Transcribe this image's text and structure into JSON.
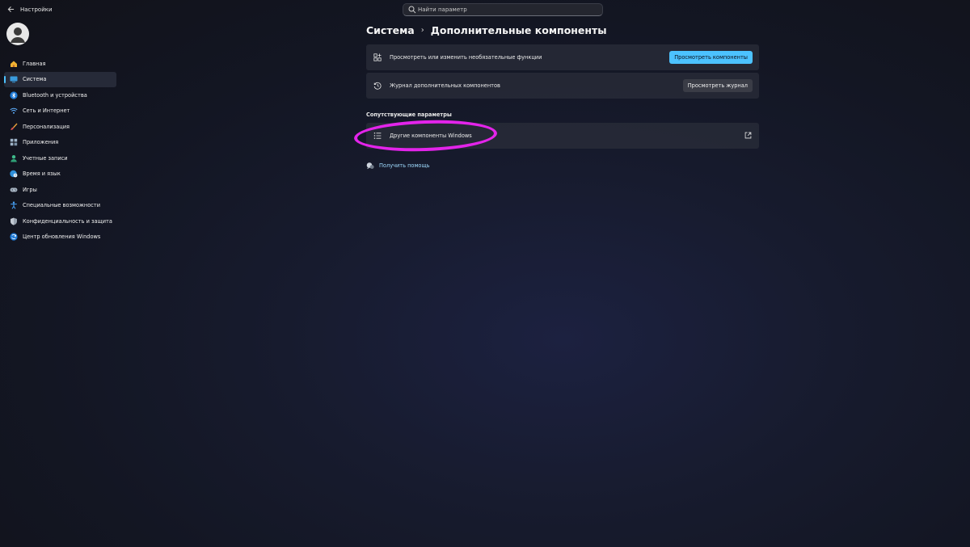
{
  "window": {
    "back_icon": "back-arrow-icon",
    "title": "Настройки"
  },
  "search": {
    "placeholder": "Найти параметр",
    "value": ""
  },
  "sidebar": {
    "items": [
      {
        "label": "Главная",
        "icon": "home-icon",
        "active": false
      },
      {
        "label": "Система",
        "icon": "system-icon",
        "active": true
      },
      {
        "label": "Bluetooth и устройства",
        "icon": "bluetooth-icon",
        "active": false
      },
      {
        "label": "Сеть и Интернет",
        "icon": "wifi-icon",
        "active": false
      },
      {
        "label": "Персонализация",
        "icon": "brush-icon",
        "active": false
      },
      {
        "label": "Приложения",
        "icon": "apps-icon",
        "active": false
      },
      {
        "label": "Учетные записи",
        "icon": "account-icon",
        "active": false
      },
      {
        "label": "Время и язык",
        "icon": "globe-clock-icon",
        "active": false
      },
      {
        "label": "Игры",
        "icon": "gamepad-icon",
        "active": false
      },
      {
        "label": "Специальные возможности",
        "icon": "accessibility-icon",
        "active": false
      },
      {
        "label": "Конфиденциальность и защита",
        "icon": "shield-icon",
        "active": false
      },
      {
        "label": "Центр обновления Windows",
        "icon": "update-icon",
        "active": false
      }
    ]
  },
  "breadcrumb": {
    "parent": "Система",
    "separator": "›",
    "current": "Дополнительные компоненты"
  },
  "cards": {
    "optional_features": {
      "label": "Просмотреть или изменить необязательные функции",
      "button": "Просмотреть компоненты"
    },
    "history": {
      "label": "Журнал дополнительных компонентов",
      "button": "Просмотреть журнал"
    }
  },
  "related": {
    "heading": "Сопутствующие параметры",
    "item_label": "Другие компоненты Windows"
  },
  "help": {
    "label": "Получить помощь"
  },
  "colors": {
    "accent": "#4cc2ff",
    "highlight": "#e324ea",
    "card_bg": "#2b2e3a"
  }
}
